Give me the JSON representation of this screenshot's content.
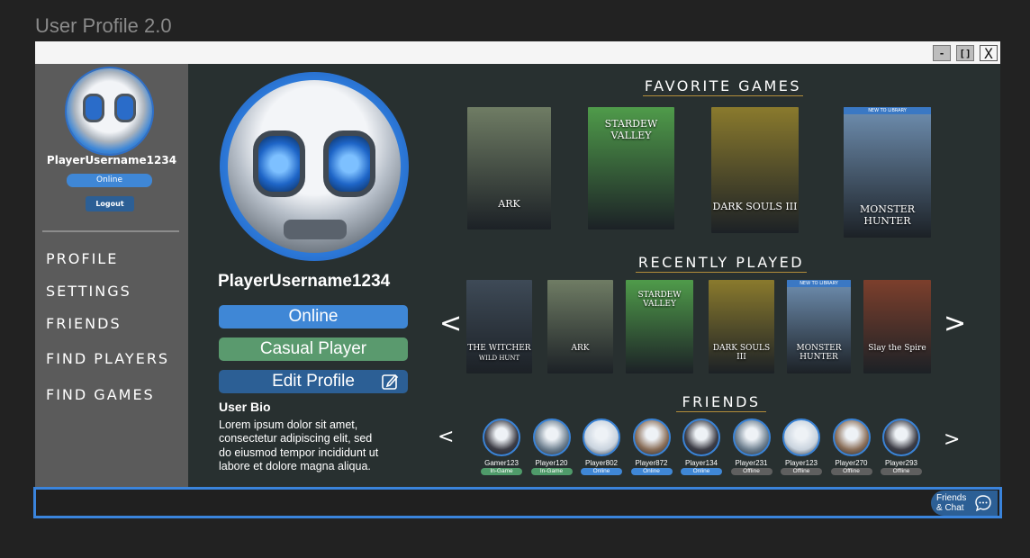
{
  "app": {
    "title": "User Profile 2.0"
  },
  "window_controls": {
    "minimize": "-",
    "maximize": "[]",
    "close": "X"
  },
  "sidebar": {
    "username": "PlayerUsername1234",
    "status": "Online",
    "logout": "Logout",
    "nav": [
      {
        "label": "PROFILE"
      },
      {
        "label": "SETTINGS"
      },
      {
        "label": "FRIENDS"
      },
      {
        "label": "FIND PLAYERS"
      },
      {
        "label": "FIND GAMES"
      }
    ]
  },
  "profile": {
    "username": "PlayerUsername1234",
    "status": "Online",
    "player_type": "Casual Player",
    "edit_label": "Edit Profile",
    "bio_title": "User Bio",
    "bio_text": "Lorem ipsum dolor sit amet, consectetur adipiscing elit, sed do eiusmod tempor incididunt ut labore et dolore magna aliqua."
  },
  "favorite_games": {
    "title": "FAVORITE GAMES",
    "games": [
      {
        "name": "ARK",
        "color": "#6f7c64"
      },
      {
        "name": "STARDEW VALLEY",
        "color": "#4f9b4a"
      },
      {
        "name": "DARK SOULS III",
        "color": "#8a7a2d"
      },
      {
        "name": "MONSTER HUNTER",
        "color": "#6f8fb1",
        "tag": "NEW TO LIBRARY"
      }
    ]
  },
  "recently_played": {
    "title": "RECENTLY PLAYED",
    "prev": "<",
    "next": ">",
    "games": [
      {
        "name": "THE WITCHER",
        "sub": "WILD HUNT",
        "color": "#3e4a57"
      },
      {
        "name": "ARK",
        "color": "#6f7c64"
      },
      {
        "name": "STARDEW VALLEY",
        "color": "#4f9b4a"
      },
      {
        "name": "DARK SOULS III",
        "color": "#8a7a2d"
      },
      {
        "name": "MONSTER HUNTER",
        "color": "#6f8fb1",
        "tag": "NEW TO LIBRARY"
      },
      {
        "name": "Slay the Spire",
        "color": "#7c3f2c"
      }
    ]
  },
  "friends": {
    "title": "FRIENDS",
    "prev": "<",
    "next": ">",
    "list": [
      {
        "name": "Gamer123",
        "status": "In-Game",
        "status_color": "#4f9b6a",
        "avatar_color": "#3d3d46"
      },
      {
        "name": "Player120",
        "status": "In-Game",
        "status_color": "#4f9b6a",
        "avatar_color": "#6e8090"
      },
      {
        "name": "Player802",
        "status": "Online",
        "status_color": "#3f87d6",
        "avatar_color": "#c9d3de"
      },
      {
        "name": "Player872",
        "status": "Online",
        "status_color": "#3f87d6",
        "avatar_color": "#8a6e58"
      },
      {
        "name": "Player134",
        "status": "Online",
        "status_color": "#3f87d6",
        "avatar_color": "#3d3d46"
      },
      {
        "name": "Player231",
        "status": "Offline",
        "status_color": "#5f5f5f",
        "avatar_color": "#6e8090"
      },
      {
        "name": "Player123",
        "status": "Offline",
        "status_color": "#5f5f5f",
        "avatar_color": "#c9d3de"
      },
      {
        "name": "Player270",
        "status": "Offline",
        "status_color": "#5f5f5f",
        "avatar_color": "#8a6e58"
      },
      {
        "name": "Player293",
        "status": "Offline",
        "status_color": "#5f5f5f",
        "avatar_color": "#3d3d46"
      }
    ]
  },
  "chat": {
    "line1": "Friends",
    "line2": "& Chat"
  }
}
